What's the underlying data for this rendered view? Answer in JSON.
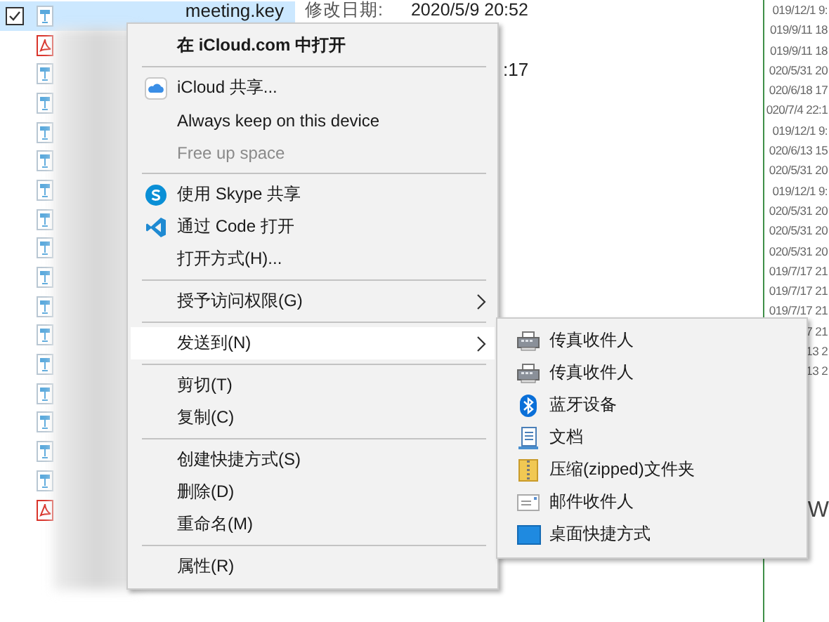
{
  "file_list": {
    "rows": [
      {
        "kind": "keynote",
        "selected": true,
        "checked": true,
        "name": "meeting.key"
      },
      {
        "kind": "pdf",
        "selected": false,
        "checked": false
      },
      {
        "kind": "keynote",
        "selected": false,
        "checked": false
      },
      {
        "kind": "keynote",
        "selected": false,
        "checked": false
      },
      {
        "kind": "keynote",
        "selected": false,
        "checked": false
      },
      {
        "kind": "keynote",
        "selected": false,
        "checked": false
      },
      {
        "kind": "keynote",
        "selected": false,
        "checked": false
      },
      {
        "kind": "keynote",
        "selected": false,
        "checked": false
      },
      {
        "kind": "keynote",
        "selected": false,
        "checked": false
      },
      {
        "kind": "keynote",
        "selected": false,
        "checked": false
      },
      {
        "kind": "keynote",
        "selected": false,
        "checked": false
      },
      {
        "kind": "keynote",
        "selected": false,
        "checked": false
      },
      {
        "kind": "keynote",
        "selected": false,
        "checked": false
      },
      {
        "kind": "keynote",
        "selected": false,
        "checked": false
      },
      {
        "kind": "keynote",
        "selected": false,
        "checked": false
      },
      {
        "kind": "keynote",
        "selected": false,
        "checked": false
      },
      {
        "kind": "keynote",
        "selected": false,
        "checked": false
      },
      {
        "kind": "pdf",
        "selected": false,
        "checked": false
      }
    ]
  },
  "details": {
    "label": "修改日期:",
    "value": "2020/5/9 20:52",
    "second_value": ":17"
  },
  "date_column": [
    "019/12/1 9:",
    "019/9/11 18",
    "019/9/11 18",
    "020/5/31 20",
    "020/6/18 17",
    "020/7/4 22:1",
    "019/12/1 9:",
    "020/6/13 15",
    "020/5/31 20",
    "019/12/1 9:",
    "020/5/31 20",
    "020/5/31 20",
    "020/5/31 20",
    "019/7/17 21",
    "019/7/17 21",
    "019/7/17 21",
    "7 21",
    "13 2",
    "13 2"
  ],
  "preview_text": "W",
  "context_menu": {
    "items": [
      {
        "kind": "header",
        "label": "在 iCloud.com 中打开"
      },
      {
        "kind": "separator"
      },
      {
        "kind": "item",
        "label": "iCloud 共享...",
        "disabled": false,
        "selected": false,
        "submenu": false
      },
      {
        "kind": "item",
        "label": "Always keep on this device",
        "disabled": false,
        "selected": false,
        "submenu": false
      },
      {
        "kind": "item",
        "label": "Free up space",
        "disabled": true,
        "selected": false,
        "submenu": false
      },
      {
        "kind": "separator"
      },
      {
        "kind": "item",
        "label": "使用 Skype 共享",
        "disabled": false,
        "selected": false,
        "submenu": false
      },
      {
        "kind": "item",
        "label": "通过 Code 打开",
        "disabled": false,
        "selected": false,
        "submenu": false
      },
      {
        "kind": "item",
        "label": "打开方式(H)...",
        "disabled": false,
        "selected": false,
        "submenu": false
      },
      {
        "kind": "separator"
      },
      {
        "kind": "item",
        "label": "授予访问权限(G)",
        "disabled": false,
        "selected": false,
        "submenu": true
      },
      {
        "kind": "separator"
      },
      {
        "kind": "item",
        "label": "发送到(N)",
        "disabled": false,
        "selected": true,
        "submenu": true
      },
      {
        "kind": "separator"
      },
      {
        "kind": "item",
        "label": "剪切(T)",
        "disabled": false,
        "selected": false,
        "submenu": false
      },
      {
        "kind": "item",
        "label": "复制(C)",
        "disabled": false,
        "selected": false,
        "submenu": false
      },
      {
        "kind": "separator"
      },
      {
        "kind": "item",
        "label": "创建快捷方式(S)",
        "disabled": false,
        "selected": false,
        "submenu": false
      },
      {
        "kind": "item",
        "label": "删除(D)",
        "disabled": false,
        "selected": false,
        "submenu": false
      },
      {
        "kind": "item",
        "label": "重命名(M)",
        "disabled": false,
        "selected": false,
        "submenu": false
      },
      {
        "kind": "separator"
      },
      {
        "kind": "item",
        "label": "属性(R)",
        "disabled": false,
        "selected": false,
        "submenu": false
      }
    ]
  },
  "send_to_menu": {
    "items": [
      {
        "label": "传真收件人"
      },
      {
        "label": "传真收件人"
      },
      {
        "label": "蓝牙设备"
      },
      {
        "label": "文档"
      },
      {
        "label": "压缩(zipped)文件夹"
      },
      {
        "label": "邮件收件人"
      },
      {
        "label": "桌面快捷方式"
      }
    ]
  }
}
